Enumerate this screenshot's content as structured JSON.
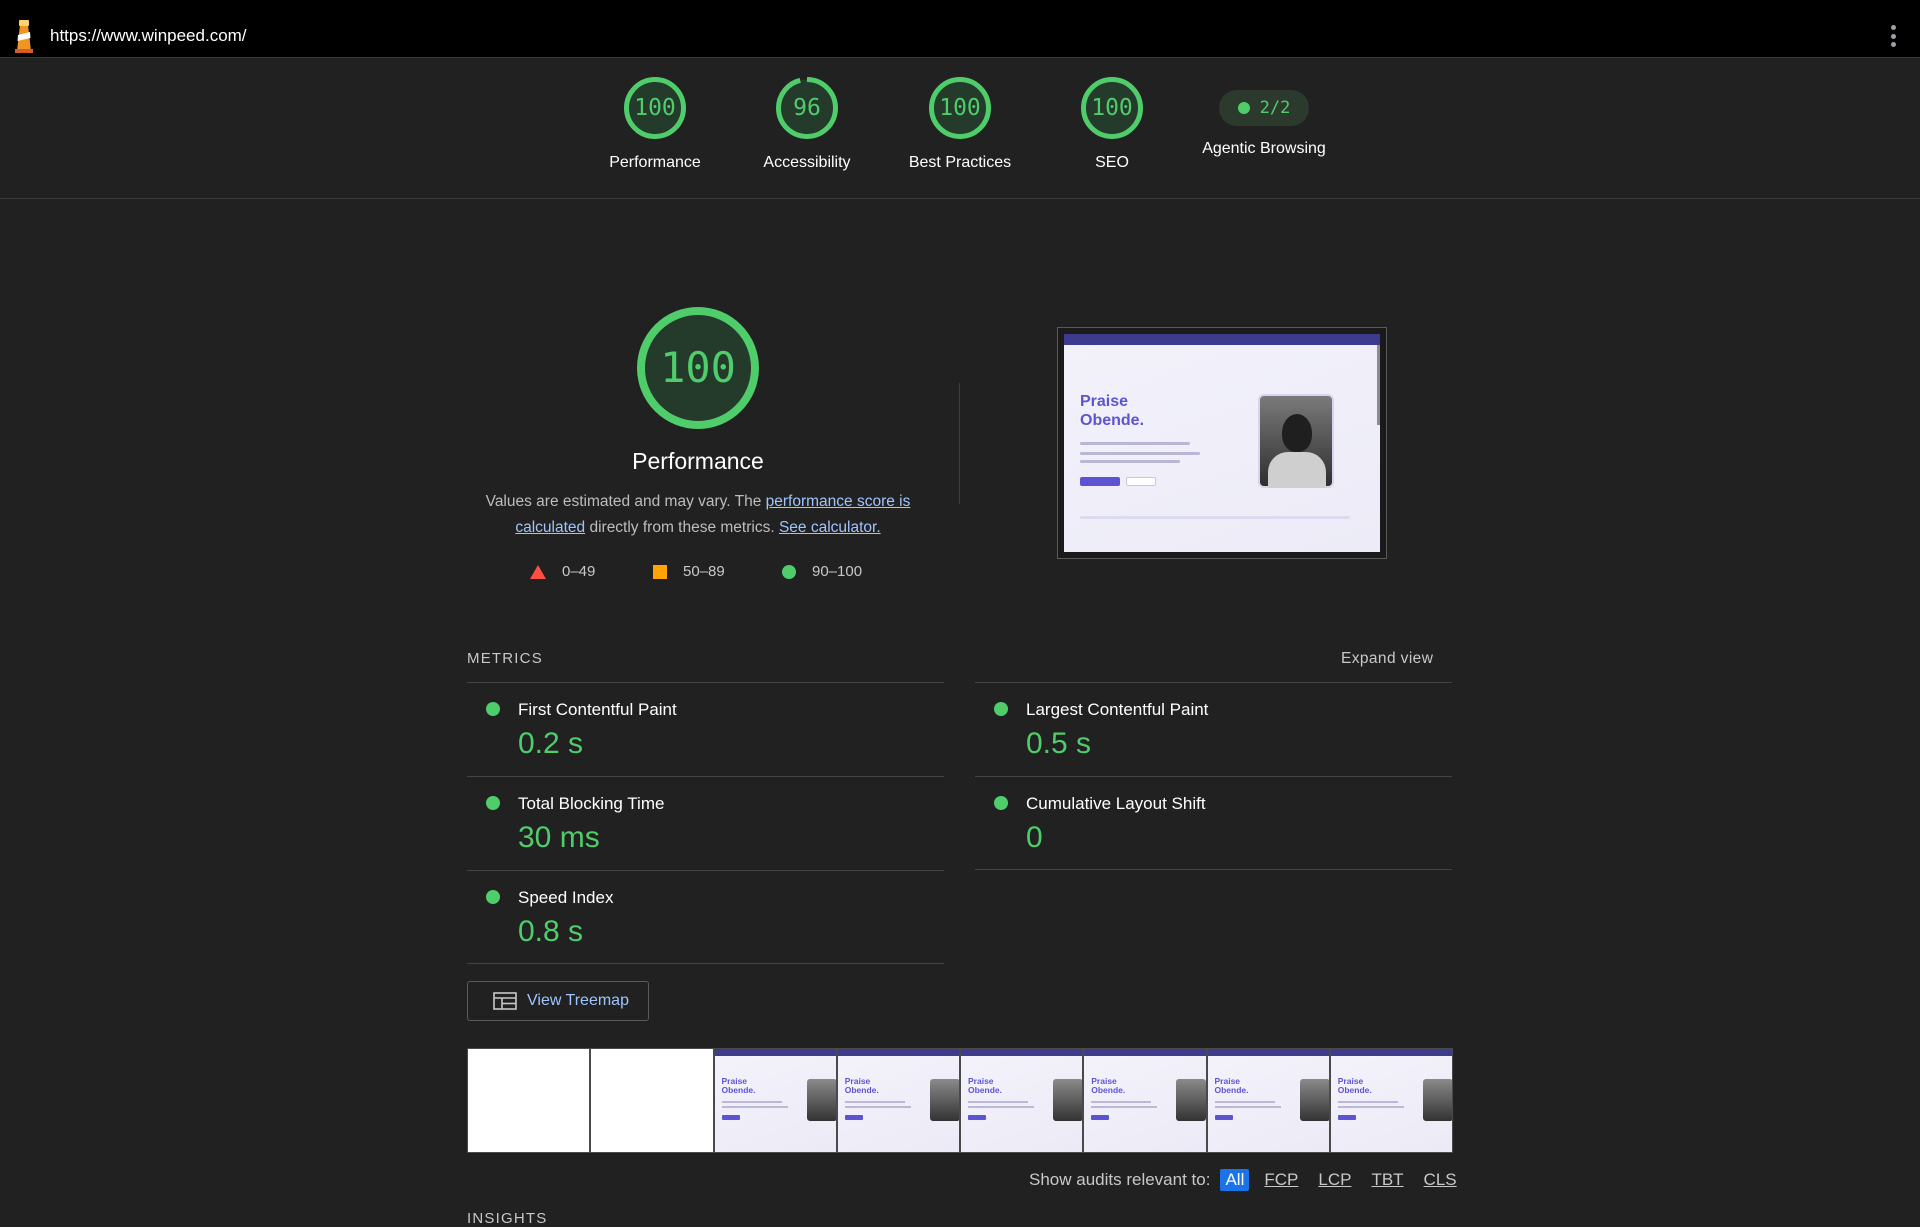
{
  "topbar": {
    "url": "https://www.winpeed.com/"
  },
  "gauges": [
    {
      "score": "100",
      "label": "Performance",
      "value": 1.0
    },
    {
      "score": "96",
      "label": "Accessibility",
      "value": 0.96
    },
    {
      "score": "100",
      "label": "Best Practices",
      "value": 1.0
    },
    {
      "score": "100",
      "label": "SEO",
      "value": 1.0
    },
    {
      "score": "2/2",
      "label": "Agentic Browsing"
    }
  ],
  "performance": {
    "score": "100",
    "value": 1.0,
    "title": "Performance",
    "desc_start": "Values are estimated and may vary. The ",
    "link_score": "performance score is calculated",
    "desc_mid": " directly from these metrics. ",
    "link_calc": "See calculator.",
    "legend": [
      "0–49",
      "50–89",
      "90–100"
    ]
  },
  "screenshot": {
    "heading_line1": "Praise",
    "heading_line2": "Obende."
  },
  "metrics": {
    "heading": "METRICS",
    "expand": "Expand view",
    "items": [
      {
        "label": "First Contentful Paint",
        "value": "0.2 s"
      },
      {
        "label": "Largest Contentful Paint",
        "value": "0.5 s"
      },
      {
        "label": "Total Blocking Time",
        "value": "30 ms"
      },
      {
        "label": "Cumulative Layout Shift",
        "value": "0"
      },
      {
        "label": "Speed Index",
        "value": "0.8 s"
      }
    ]
  },
  "treemap": {
    "label": "View Treemap"
  },
  "filmstrip": {
    "frame_line1": "Praise",
    "frame_line2": "Obende."
  },
  "audits": {
    "prompt": "Show audits relevant to:",
    "filters": [
      "All",
      "FCP",
      "LCP",
      "TBT",
      "CLS"
    ]
  },
  "insights": {
    "heading": "INSIGHTS"
  },
  "colors": {
    "pass": "#4fcd6b",
    "average": "#ffa400",
    "fail": "#ff4e42",
    "link": "#9fc5ff",
    "accent": "#1a73e8"
  }
}
